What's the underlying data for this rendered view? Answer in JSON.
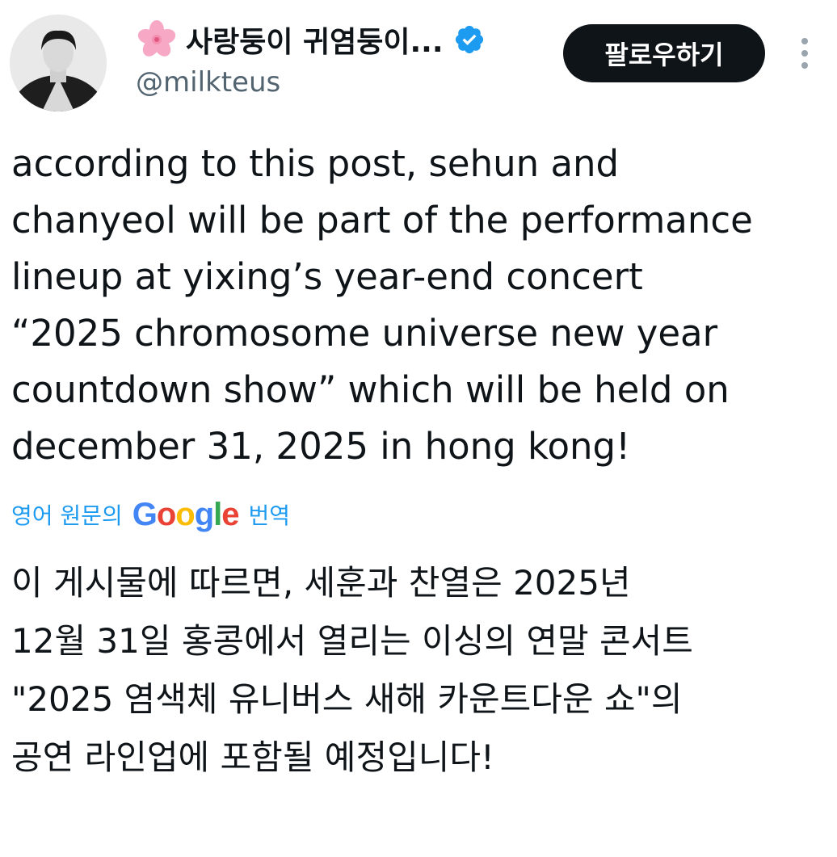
{
  "author": {
    "flower_icon": "cherry-blossom-emoji",
    "display_name": "사랑둥이 귀염둥이...",
    "verified_icon": "verified-badge-icon",
    "handle": "@milkteus"
  },
  "header": {
    "follow_label": "팔로우하기",
    "more_icon": "more-vertical-icon"
  },
  "tweet": {
    "lines": [
      "according to this post, sehun and",
      "chanyeol will be part of the performance",
      "lineup at yixing’s year-end concert",
      "“2025 chromosome universe new year",
      "countdown show” which will be held on",
      "december 31, 2025 in hong kong!"
    ]
  },
  "translation": {
    "prefix": "영어 원문의",
    "brand": "Google",
    "suffix": "번역",
    "lines": [
      "이 게시물에 따르면, 세훈과 찬열은 2025년",
      "12월 31일 홍콩에서 열리는 이싱의 연말 콘서트",
      "\"2025 염색체 유니버스 새해 카운트다운 쇼\"의",
      "공연 라인업에 포함될 예정입니다!"
    ]
  },
  "colors": {
    "text": "#0f1419",
    "secondary": "#536471",
    "link": "#1d9bf0",
    "verified": "#1d9bf0",
    "button_bg": "#0f1419"
  }
}
